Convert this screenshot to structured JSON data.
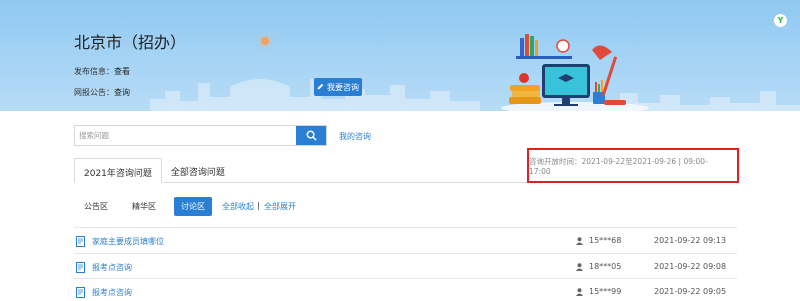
{
  "banner": {
    "title": "北京市（招办）",
    "publish_label": "发布信息：",
    "publish_link": "查看",
    "notice_label": "网报公告：",
    "notice_link": "查询",
    "ask_button": "我要咨询",
    "logo_glyph": "Y"
  },
  "search": {
    "placeholder": "搜索问题",
    "my_questions": "我的咨询"
  },
  "tabs": [
    "2021年咨询问题",
    "全部咨询问题"
  ],
  "consult_time": "咨询开放时间：2021-09-22至2021-09-26 | 09:00-17:00",
  "zones": {
    "public": "公告区",
    "featured": "精华区",
    "discussion": "讨论区",
    "collapse_all": "全部收起",
    "separator": "|",
    "expand_all": "全部展开"
  },
  "questions": [
    {
      "title": "家庭主要成员填哪位",
      "user": "15***68",
      "time": "2021-09-22 09:13"
    },
    {
      "title": "报考点咨询",
      "user": "18***05",
      "time": "2021-09-22 09:08"
    },
    {
      "title": "报考点咨询",
      "user": "15***99",
      "time": "2021-09-22 09:05"
    }
  ],
  "colors": {
    "accent": "#2a7fd4",
    "highlight_border": "#e02020"
  }
}
